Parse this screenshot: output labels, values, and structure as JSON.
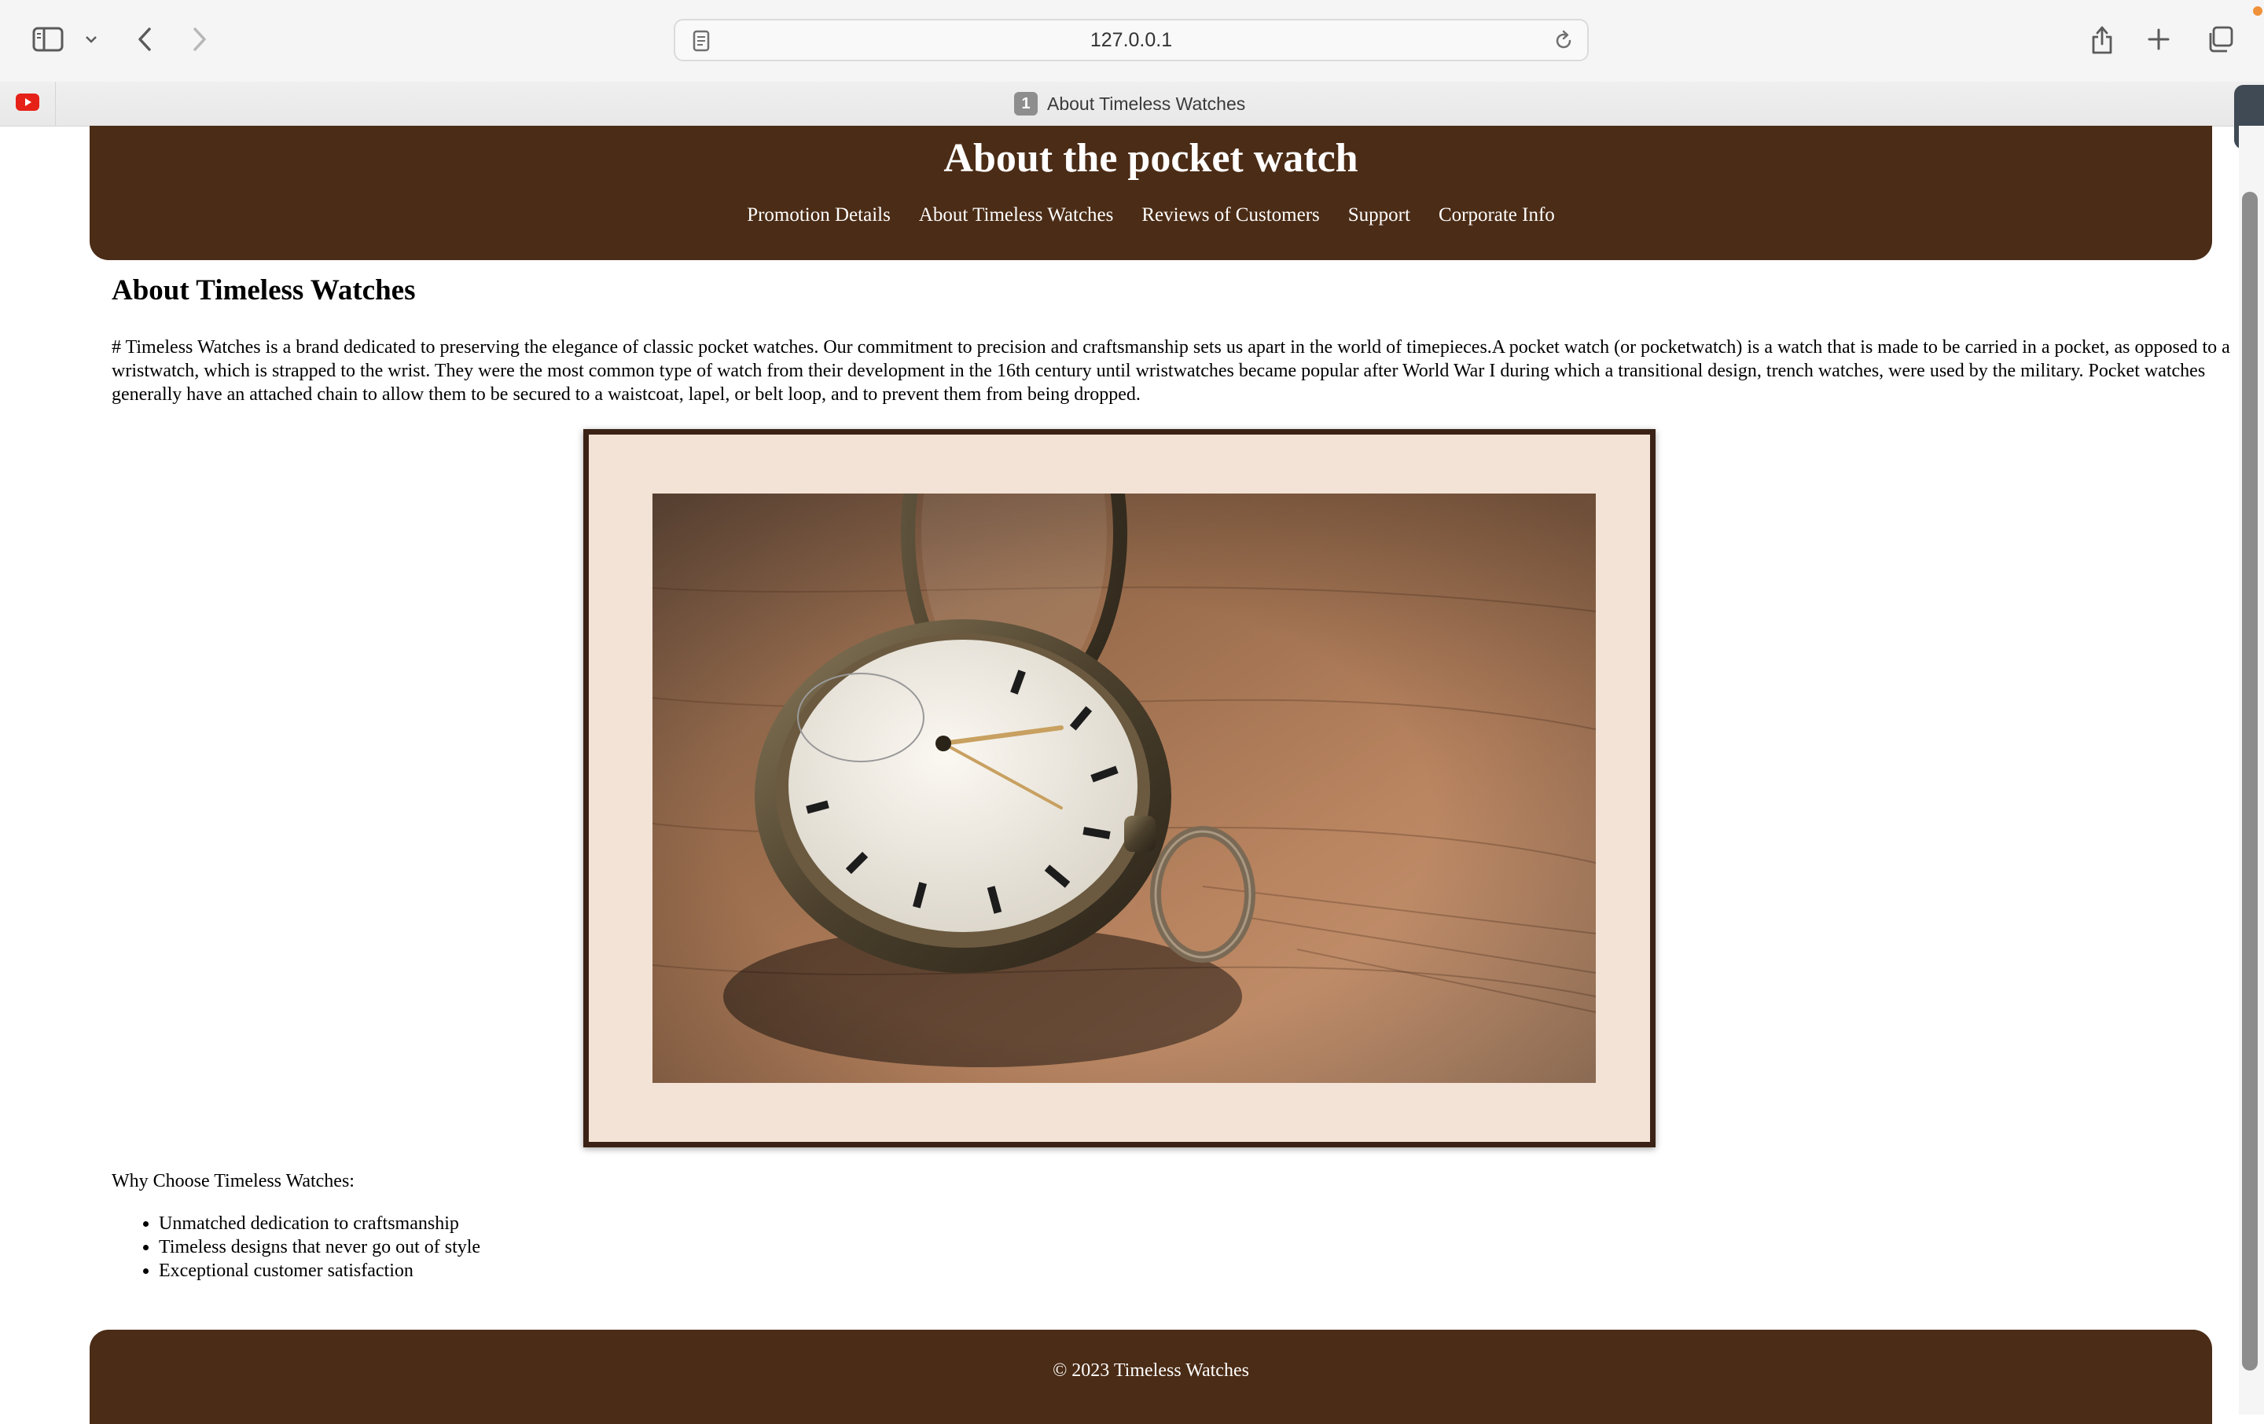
{
  "browser": {
    "url": "127.0.0.1",
    "active_tab": {
      "index": "1",
      "title": "About Timeless Watches"
    },
    "pinned_tab_icon": "youtube-icon",
    "icons": [
      "sidebar-icon",
      "chevron-down-icon",
      "back-arrow-icon",
      "forward-arrow-icon",
      "page-icon",
      "reload-icon",
      "share-icon",
      "plus-icon",
      "tabs-overview-icon"
    ]
  },
  "header": {
    "title": "About the pocket watch",
    "nav": [
      "Promotion Details",
      "About Timeless Watches",
      "Reviews of Customers",
      "Support",
      "Corporate Info"
    ]
  },
  "main": {
    "heading": "About Timeless Watches",
    "intro": "# Timeless Watches is a brand dedicated to preserving the elegance of classic pocket watches. Our commitment to precision and craftsmanship sets us apart in the world of timepieces.A pocket watch (or pocketwatch) is a watch that is made to be carried in a pocket, as opposed to a wristwatch, which is strapped to the wrist. They were the most common type of watch from their development in the 16th century until wristwatches became popular after World War I during which a transitional design, trench watches, were used by the military. Pocket watches generally have an attached chain to allow them to be secured to a waistcoat, lapel, or belt loop, and to prevent them from being dropped.",
    "why_title": "Why Choose Timeless Watches:",
    "why_items": [
      "Unmatched dedication to craftsmanship",
      "Timeless designs that never go out of style",
      "Exceptional customer satisfaction"
    ]
  },
  "footer": {
    "text": "© 2023 Timeless Watches"
  },
  "colors": {
    "brand_brown": "#4b2c16",
    "frame_border": "#3b2216",
    "frame_mat": "#f3e3d6"
  }
}
